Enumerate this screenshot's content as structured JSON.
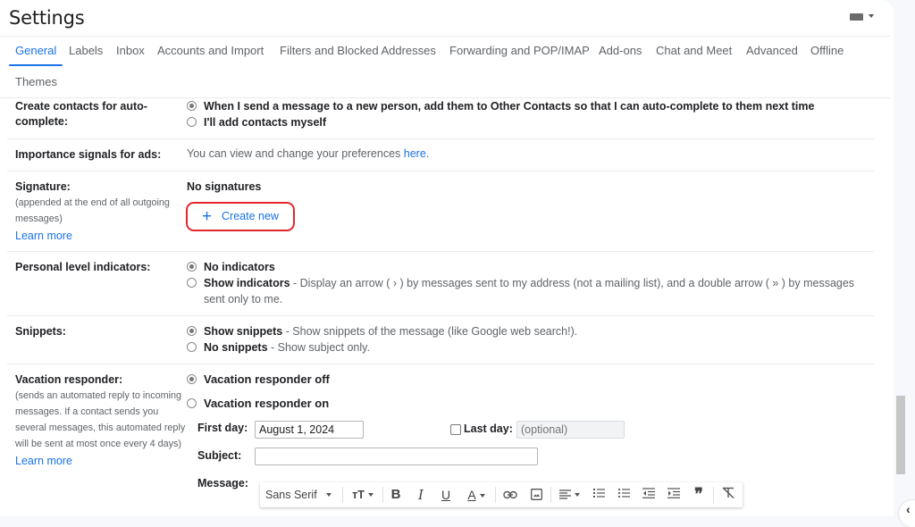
{
  "header": {
    "title": "Settings",
    "keyboard_icon": "keyboard-icon"
  },
  "tabs": [
    {
      "label": "General",
      "active": true
    },
    {
      "label": "Labels"
    },
    {
      "label": "Inbox"
    },
    {
      "label": "Accounts and Import"
    },
    {
      "label": "Filters and Blocked Addresses"
    },
    {
      "label": "Forwarding and POP/IMAP"
    },
    {
      "label": "Add-ons"
    },
    {
      "label": "Chat and Meet"
    },
    {
      "label": "Advanced"
    },
    {
      "label": "Offline"
    },
    {
      "label": "Themes"
    }
  ],
  "contacts": {
    "label_line1": "Create contacts for auto-",
    "label_line2": "complete:",
    "options": [
      {
        "label": "When I send a message to a new person, add them to Other Contacts so that I can auto-complete to them next time",
        "selected": true
      },
      {
        "label": "I'll add contacts myself",
        "selected": false
      }
    ]
  },
  "ads": {
    "label": "Importance signals for ads:",
    "text": "You can view and change your preferences ",
    "link": "here",
    "suffix": "."
  },
  "signature": {
    "label": "Signature:",
    "sub_line1": "(appended at the end of all outgoing",
    "sub_line2": "messages)",
    "learn_more": "Learn more",
    "status": "No signatures",
    "create_new": "Create new",
    "highlight_color": "#e3262b"
  },
  "personal_indicators": {
    "label": "Personal level indicators:",
    "options": [
      {
        "title": "No indicators",
        "desc": "",
        "selected": true
      },
      {
        "title": "Show indicators",
        "desc": " - Display an arrow ( › ) by messages sent to my address (not a mailing list), and a double arrow ( » ) by messages",
        "desc_line2": "sent only to me.",
        "selected": false
      }
    ]
  },
  "snippets": {
    "label": "Snippets:",
    "options": [
      {
        "title": "Show snippets",
        "desc": " - Show snippets of the message (like Google web search!).",
        "selected": true
      },
      {
        "title": "No snippets",
        "desc": " - Show subject only.",
        "selected": false
      }
    ]
  },
  "vacation": {
    "label": "Vacation responder:",
    "sub_lines": [
      "(sends an automated reply to incoming",
      "messages. If a contact sends you",
      "several messages, this automated reply",
      "will be sent at most once every 4 days)"
    ],
    "learn_more": "Learn more",
    "options": [
      {
        "label": "Vacation responder off",
        "selected": true
      },
      {
        "label": "Vacation responder on",
        "selected": false
      }
    ],
    "first_day_label": "First day:",
    "first_day_value": "August 1, 2024",
    "last_day_label": "Last day:",
    "last_day_placeholder": "(optional)",
    "last_day_checked": false,
    "subject_label": "Subject:",
    "subject_value": "",
    "message_label": "Message:"
  },
  "toolbar": {
    "font": "Sans Serif",
    "size_icon": "ᴛT",
    "bold": "B",
    "italic": "I",
    "underline": "U",
    "text_color": "A",
    "quote": "”"
  },
  "colors": {
    "accent": "#1a73e8",
    "highlight": "#e3262b"
  }
}
